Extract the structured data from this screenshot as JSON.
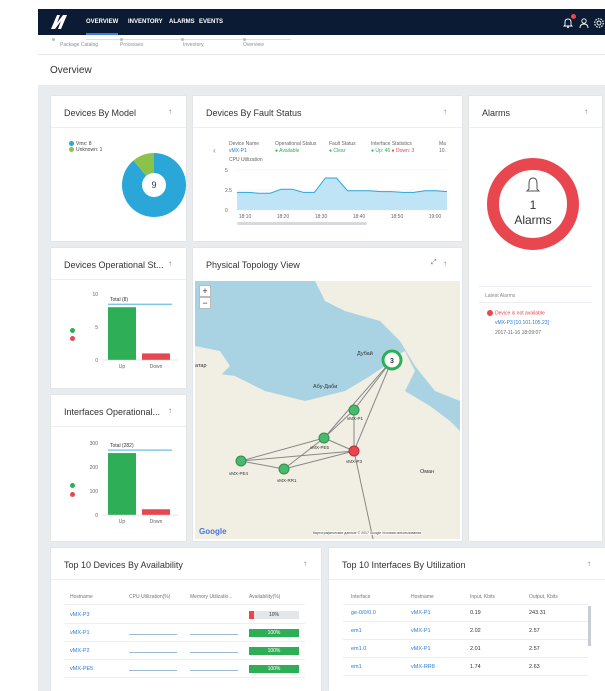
{
  "nav": {
    "items": [
      "OVERVIEW",
      "INVENTORY",
      "ALARMS",
      "EVENTS"
    ],
    "active": "OVERVIEW"
  },
  "breadcrumb": {
    "steps": [
      "Package Catalog",
      "Processes",
      "Inventory",
      "Overview"
    ]
  },
  "page": {
    "title": "Overview"
  },
  "devices_by_model": {
    "title": "Devices By Model",
    "legend": [
      "Vmx: 8",
      "Unknown: 1"
    ],
    "center_value": "9",
    "chart_data": {
      "type": "pie",
      "labels": [
        "Vmx",
        "Unknown"
      ],
      "values": [
        8,
        1
      ],
      "colors": [
        "#2aa6d8",
        "#8bc34a"
      ]
    }
  },
  "fault_status": {
    "title": "Devices By Fault Status",
    "headers": [
      "Device Name",
      "Operational Status",
      "Fault Status",
      "Interface Statistics",
      "Ma"
    ],
    "row": {
      "device": "vMX-P1",
      "operational": "Available",
      "fault": "Clear",
      "iface_up": "Up: 46",
      "iface_down": "Down: 3",
      "extra": "10."
    },
    "cpu_label": "CPU Utilization",
    "chart_data": {
      "type": "area",
      "x": [
        "18:10",
        "18:20",
        "18:30",
        "18:40",
        "18:50",
        "19:00"
      ],
      "ylim": [
        0,
        5
      ],
      "yticks": [
        "5",
        "2.5",
        "0"
      ],
      "series": [
        {
          "values": [
            2.2,
            2.2,
            2.1,
            2.1,
            2.6,
            2.6,
            2.2,
            2.2,
            4.0,
            4.0,
            2.4,
            2.4,
            2.4,
            2.3,
            2.3,
            2.2,
            2.2,
            2.4,
            2.4,
            2.3
          ]
        }
      ]
    }
  },
  "alarms": {
    "title": "Alarms",
    "count": "1",
    "label": "Alarms",
    "latest_title": "Latest Alarms",
    "latest_message": "Device is not available",
    "latest_device": "vMX-P3 [10.101.105.23]",
    "latest_time": "2017-11-16 18:09:07"
  },
  "devices_operational": {
    "title": "Devices Operational St...",
    "total_label": "Total (8)",
    "chart_data": {
      "type": "bar",
      "categories": [
        "Up",
        "Down"
      ],
      "values": [
        8,
        1
      ],
      "colors": [
        "#2fae58",
        "#e8474f"
      ],
      "ylim": [
        0,
        10
      ],
      "yticks": [
        "10",
        "5",
        "0"
      ]
    }
  },
  "interfaces_operational": {
    "title": "Interfaces Operational...",
    "total_label": "Total (282)",
    "chart_data": {
      "type": "bar",
      "categories": [
        "Up",
        "Down"
      ],
      "values": [
        258,
        24
      ],
      "colors": [
        "#2fae58",
        "#e8474f"
      ],
      "ylim": [
        0,
        300
      ],
      "yticks": [
        "300",
        "200",
        "100",
        "0"
      ]
    }
  },
  "topology": {
    "title": "Physical Topology View",
    "cluster_count": "3",
    "nodes": [
      "vMX-PE4",
      "vMX-RR1",
      "vMX-PE5",
      "vMX-P1",
      "vMX-P3"
    ],
    "places": [
      "Дубай",
      "Абу-Даби",
      "атар",
      "Оман"
    ],
    "google": "Google",
    "attribution": "Картографические данные © 2017 Google   Условия использования"
  },
  "availability": {
    "title": "Top 10 Devices By Availability",
    "headers": [
      "Hostname",
      "CPU Utilization(%)",
      "Memory Utilizatio...",
      "Availability(%)"
    ],
    "rows": [
      {
        "host": "vMX-P3",
        "avail": "10%",
        "pct": 10
      },
      {
        "host": "vMX-P1",
        "avail": "100%",
        "pct": 100
      },
      {
        "host": "vMX-P2",
        "avail": "100%",
        "pct": 100
      },
      {
        "host": "vMX-PE5",
        "avail": "100%",
        "pct": 100
      }
    ]
  },
  "utilization": {
    "title": "Top 10 Interfaces By Utilization",
    "headers": [
      "Interface",
      "Hostname",
      "Input, Kbits",
      "Output, Kbits"
    ],
    "rows": [
      {
        "iface": "ge-0/0/0.0",
        "host": "vMX-P1",
        "input": "0.19",
        "output": "243.31"
      },
      {
        "iface": "em1",
        "host": "vMX-P1",
        "input": "2.02",
        "output": "2.57"
      },
      {
        "iface": "em1.0",
        "host": "vMX-P1",
        "input": "2.01",
        "output": "2.57"
      },
      {
        "iface": "em1",
        "host": "vMX-RR8",
        "input": "1.74",
        "output": "2.63"
      }
    ]
  }
}
